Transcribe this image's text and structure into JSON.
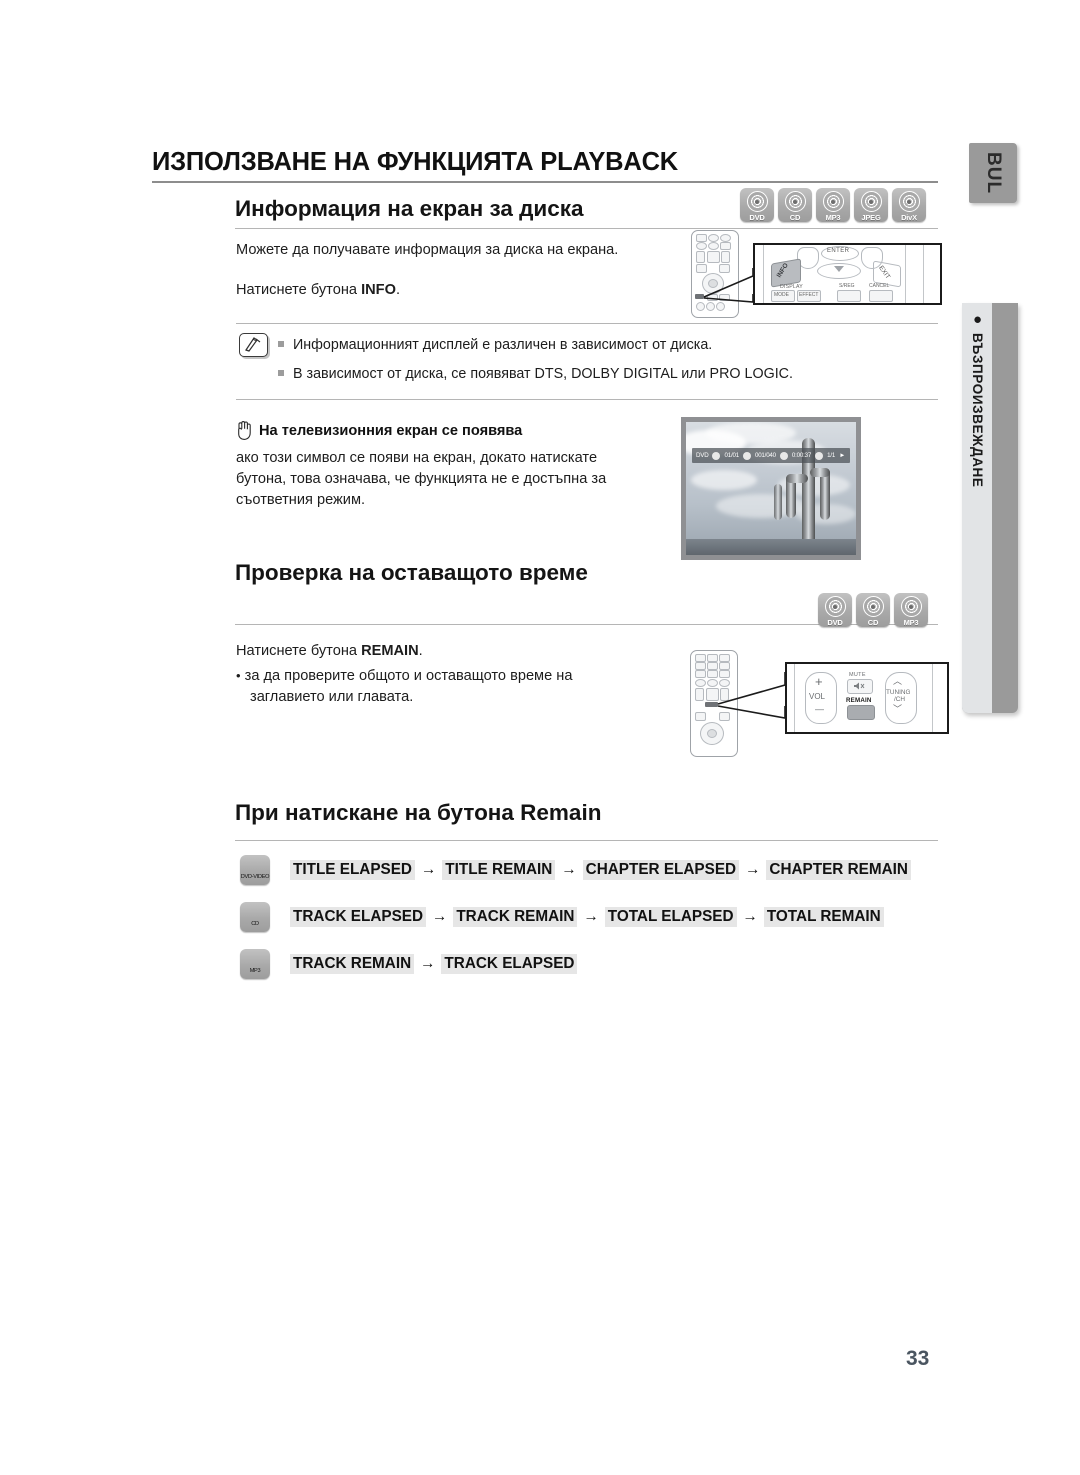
{
  "page": {
    "number": "33",
    "language_tab": "BUL",
    "side_chapter": "ВЪЗПРОИЗВЕЖДАНЕ",
    "side_chapter_bullet": "●"
  },
  "header": {
    "title": "ИЗПОЛЗВАНЕ НА ФУНКЦИЯТА PLAYBACK"
  },
  "section1": {
    "heading": "Информация на екран за диска",
    "disc_icons": [
      "DVD",
      "CD",
      "MP3",
      "JPEG",
      "DivX"
    ],
    "paragraph1": "Можете да получавате информация за диска на екрана.",
    "paragraph2_prefix": "Натиснете бутона ",
    "paragraph2_bold": "INFO",
    "paragraph2_suffix": ".",
    "note_icon": "note-pen-icon",
    "notes": [
      "Информационният дисплей е различен в зависимост от диска.",
      "В зависимост от диска, се появяват DTS, DOLBY DIGITAL или PRO LOGIC."
    ],
    "warning_icon": "hand-stop-icon",
    "warning_heading": "На телевизионния екран се появява",
    "warning_body": "ако този символ се появи на екран, докато натискате бутона, това означава, че функцията не е достъпна за съответния режим.",
    "remote_callout": {
      "enter_label": "ENTER",
      "info_label": "INFO",
      "exit_label": "EXIT",
      "display_label": "DISPLAY",
      "mode_label": "MODE",
      "effect_label": "EFFECT",
      "sleep_label": "S/REG",
      "cancel_label": "CANCEL"
    },
    "tv_osd": {
      "disc_type": "DVD",
      "title": "01/01",
      "chapter": "001/040",
      "time": "0:00:37",
      "audio": "1/1",
      "play_glyph": "►"
    }
  },
  "section2": {
    "heading": "Проверка на оставащото време",
    "disc_icons": [
      "DVD",
      "CD",
      "MP3"
    ],
    "paragraph1_prefix": "Натиснете бутона ",
    "paragraph1_bold": "REMAIN",
    "paragraph1_suffix": ".",
    "bullet": "за да проверите общото и оставащото време на заглавието или главата.",
    "remote_callout": {
      "vol_label": "VOL",
      "vol_plus": "+",
      "vol_minus": "—",
      "mute_label": "MUTE",
      "remain_label": "REMAIN",
      "tuning_label": "TUNING",
      "tuning_sub": "/CH",
      "up_glyph": "︿",
      "down_glyph": "﹀"
    }
  },
  "section3": {
    "heading": "При натискане на бутона Remain",
    "rows": [
      {
        "icon_label": "DVD-VIDEO",
        "steps": [
          "TITLE ELAPSED",
          "TITLE REMAIN",
          "CHAPTER ELAPSED",
          "CHAPTER REMAIN"
        ],
        "arrow": "→"
      },
      {
        "icon_label": "CD",
        "steps": [
          "TRACK ELAPSED",
          "TRACK REMAIN",
          "TOTAL ELAPSED",
          "TOTAL REMAIN"
        ],
        "arrow": "→"
      },
      {
        "icon_label": "MP3",
        "steps": [
          "TRACK REMAIN",
          "TRACK ELAPSED"
        ],
        "arrow": "→"
      }
    ]
  }
}
